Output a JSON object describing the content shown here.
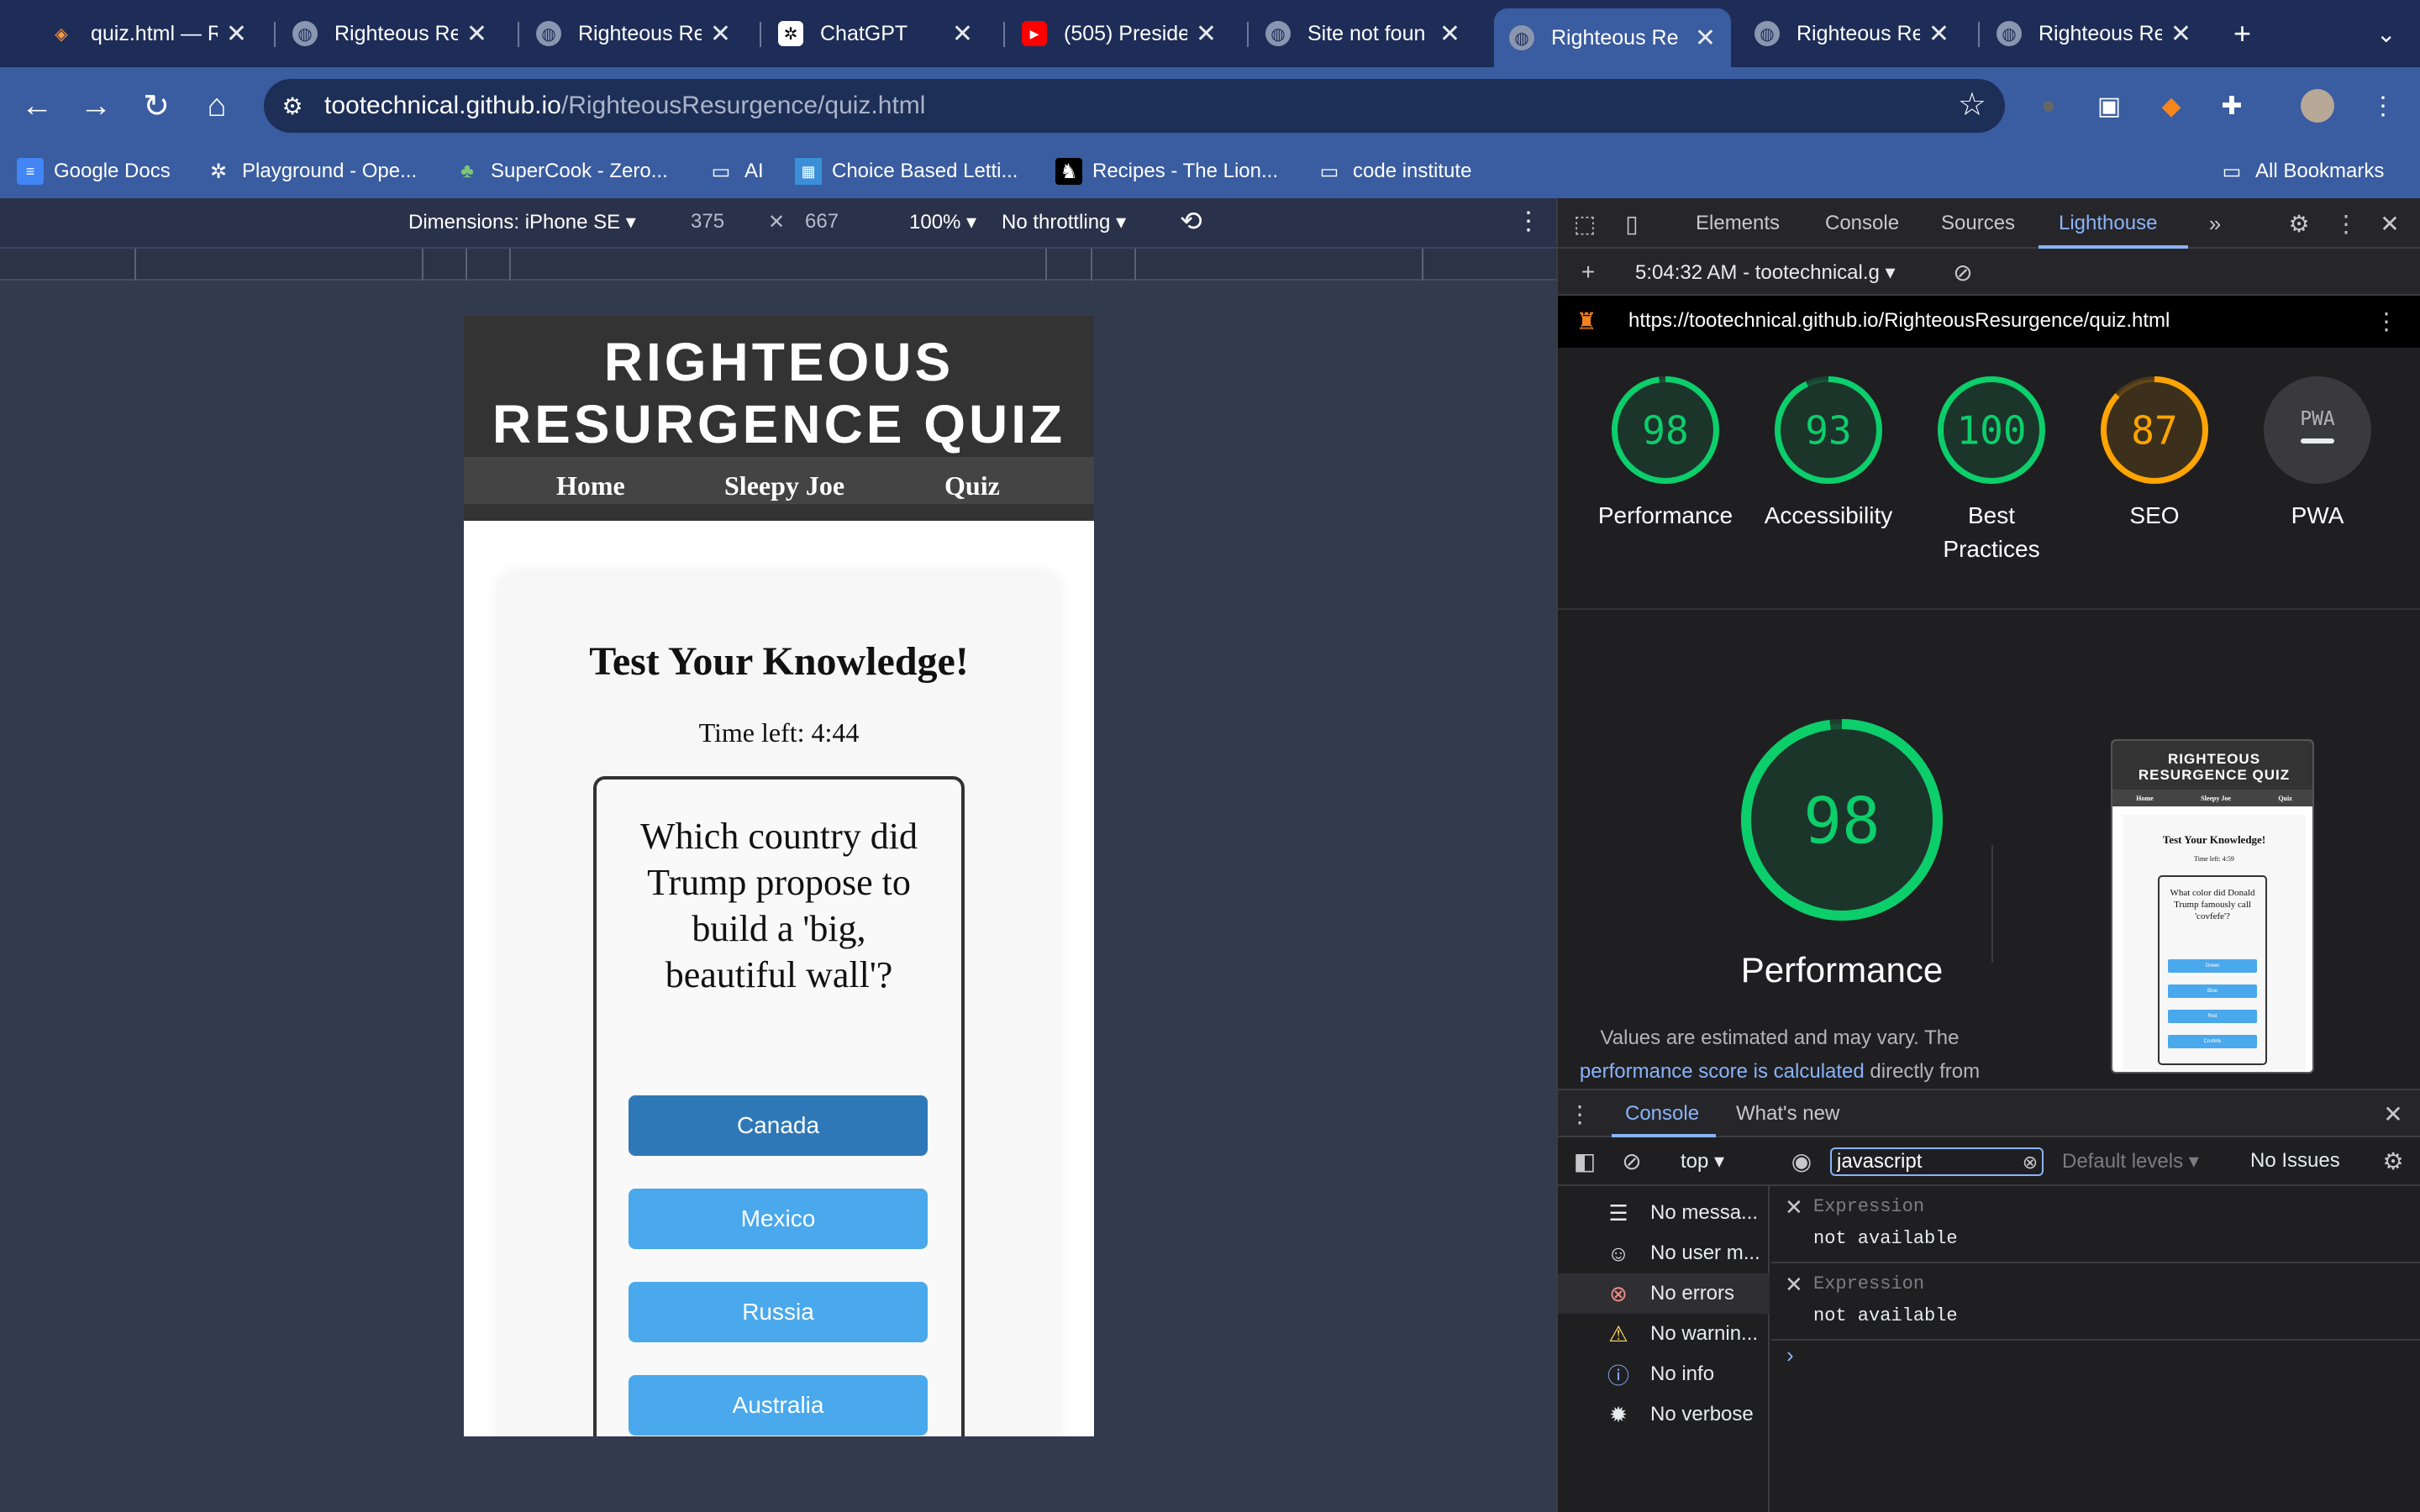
{
  "tabs": [
    {
      "title": "quiz.html — R",
      "icon": "gitpod-icon",
      "active": false
    },
    {
      "title": "Righteous Re",
      "icon": "globe-icon",
      "active": false
    },
    {
      "title": "Righteous Re",
      "icon": "globe-icon",
      "active": false
    },
    {
      "title": "ChatGPT",
      "icon": "chatgpt-icon",
      "active": false
    },
    {
      "title": "(505) Preside",
      "icon": "youtube-icon",
      "active": false
    },
    {
      "title": "Site not foun",
      "icon": "globe-icon",
      "active": false
    },
    {
      "title": "Righteous Re",
      "icon": "globe-icon",
      "active": true
    },
    {
      "title": "Righteous Re",
      "icon": "globe-icon",
      "active": false
    },
    {
      "title": "Righteous Re",
      "icon": "globe-icon",
      "active": false
    }
  ],
  "address": {
    "host": "tootechnical.github.io",
    "path": "/RighteousResurgence/quiz.html"
  },
  "bookmarks": [
    {
      "label": "Google Docs",
      "icon": "docs-icon"
    },
    {
      "label": "Playground - Ope...",
      "icon": "openai-icon"
    },
    {
      "label": "SuperCook - Zero...",
      "icon": "supercook-icon"
    },
    {
      "label": "AI",
      "icon": "folder-icon"
    },
    {
      "label": "Choice Based Letti...",
      "icon": "choice-icon"
    },
    {
      "label": "Recipes - The Lion...",
      "icon": "lion-icon"
    },
    {
      "label": "code institute",
      "icon": "folder-icon"
    }
  ],
  "all_bookmarks": "All Bookmarks",
  "device_toolbar": {
    "dimensions": "Dimensions: iPhone SE",
    "width": "375",
    "height": "667",
    "zoom": "100%",
    "throttling": "No throttling"
  },
  "site": {
    "title_line1": "RIGHTEOUS",
    "title_line2": "RESURGENCE QUIZ",
    "nav": [
      "Home",
      "Sleepy Joe",
      "Quiz"
    ],
    "heading": "Test Your Knowledge!",
    "timer": "Time left: 4:44",
    "question": "Which country did Trump propose to build a 'big, beautiful wall'?",
    "answers": [
      "Canada",
      "Mexico",
      "Russia",
      "Australia"
    ]
  },
  "devtools": {
    "tabs": [
      "Elements",
      "Console",
      "Sources",
      "Lighthouse"
    ],
    "active_tab": "Lighthouse",
    "report_selector": "5:04:32 AM - tootechnical.g",
    "report_url": "https://tootechnical.github.io/RighteousResurgence/quiz.html",
    "scores": [
      {
        "value": "98",
        "label": "Performance",
        "color": "#0cce6b",
        "fraction": 0.98
      },
      {
        "value": "93",
        "label": "Accessibility",
        "color": "#0cce6b",
        "fraction": 0.93
      },
      {
        "value": "100",
        "label": "Best Practices",
        "color": "#0cce6b",
        "fraction": 1.0
      },
      {
        "value": "87",
        "label": "SEO",
        "color": "#ffa400",
        "fraction": 0.87
      },
      {
        "value": "PWA",
        "label": "PWA",
        "color": "#888888",
        "fraction": 0
      }
    ],
    "big_score": {
      "value": "98",
      "label": "Performance",
      "fraction": 0.98
    },
    "note_prefix": "Values are estimated and may vary. The",
    "note_link": "performance score is calculated",
    "note_suffix": "directly from",
    "thumbnail": {
      "title": "RIGHTEOUS RESURGENCE QUIZ",
      "nav": [
        "Home",
        "Sleepy Joe",
        "Quiz"
      ],
      "heading": "Test Your Knowledge!",
      "timer": "Time left: 4:59",
      "question": "What color did Donald Trump famously call 'covfefe'?",
      "answers": [
        "Green",
        "Blue",
        "Red",
        "Covfefe"
      ]
    },
    "drawer_tabs": [
      "Console",
      "What's new"
    ],
    "context": "top",
    "filter": "javascript",
    "levels": "Default levels",
    "issues": "No Issues",
    "sidebar": [
      {
        "label": "No messa...",
        "icon": "list-icon"
      },
      {
        "label": "No user m...",
        "icon": "user-icon"
      },
      {
        "label": "No errors",
        "icon": "error-icon"
      },
      {
        "label": "No warnin...",
        "icon": "warning-icon"
      },
      {
        "label": "No info",
        "icon": "info-icon"
      },
      {
        "label": "No verbose",
        "icon": "bug-icon"
      }
    ],
    "expressions": [
      {
        "label": "Expression",
        "value": "not available"
      },
      {
        "label": "Expression",
        "value": "not available"
      }
    ]
  },
  "colors": {
    "pass": "#0cce6b",
    "average": "#ffa400",
    "link": "#8ab4f8",
    "answer": "#4aa8ec",
    "answer_hover": "#2f78b8"
  }
}
